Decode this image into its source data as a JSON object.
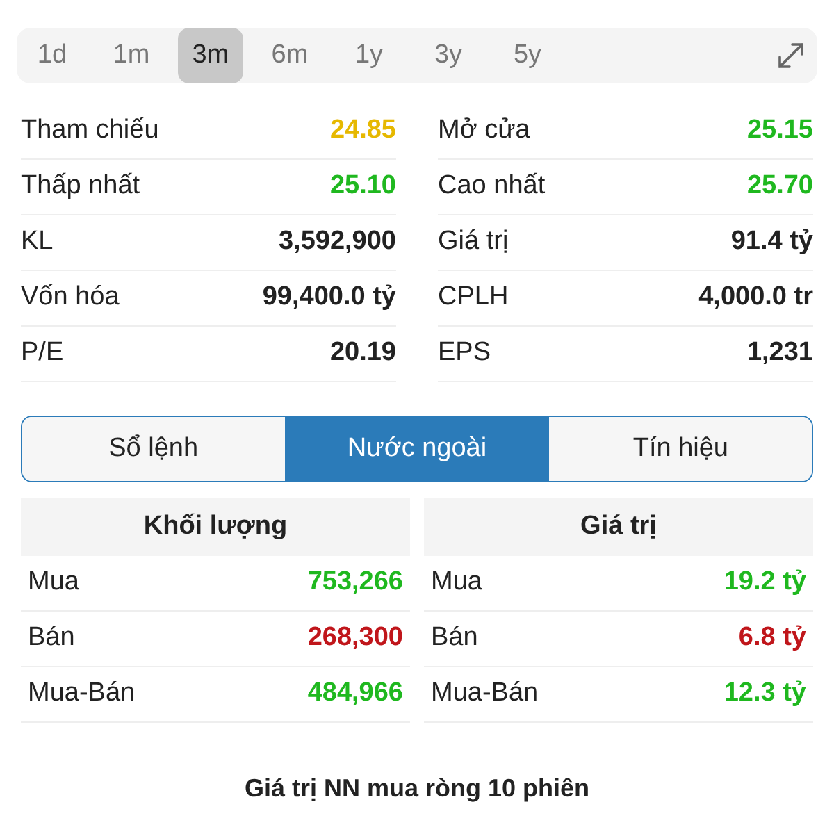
{
  "periods": [
    {
      "label": "1d",
      "selected": false
    },
    {
      "label": "1m",
      "selected": false
    },
    {
      "label": "3m",
      "selected": true
    },
    {
      "label": "6m",
      "selected": false
    },
    {
      "label": "1y",
      "selected": false
    },
    {
      "label": "3y",
      "selected": false
    },
    {
      "label": "5y",
      "selected": false
    }
  ],
  "stats_left": [
    {
      "label": "Tham chiếu",
      "value": "24.85",
      "color": "#e6b800"
    },
    {
      "label": "Thấp nhất",
      "value": "25.10",
      "color": "#1fb81f"
    },
    {
      "label": "KL",
      "value": "3,592,900",
      "color": "#222222"
    },
    {
      "label": "Vốn hóa",
      "value": "99,400.0 tỷ",
      "color": "#222222"
    },
    {
      "label": "P/E",
      "value": "20.19",
      "color": "#222222"
    }
  ],
  "stats_right": [
    {
      "label": "Mở cửa",
      "value": "25.15",
      "color": "#1fb81f"
    },
    {
      "label": "Cao nhất",
      "value": "25.70",
      "color": "#1fb81f"
    },
    {
      "label": "Giá trị",
      "value": "91.4 tỷ",
      "color": "#222222"
    },
    {
      "label": "CPLH",
      "value": "4,000.0 tr",
      "color": "#222222"
    },
    {
      "label": "EPS",
      "value": "1,231",
      "color": "#222222"
    }
  ],
  "tabs": [
    {
      "label": "Sổ lệnh",
      "selected": false
    },
    {
      "label": "Nước ngoài",
      "selected": true
    },
    {
      "label": "Tín hiệu",
      "selected": false
    }
  ],
  "tables": [
    {
      "header": "Khối lượng",
      "rows": [
        {
          "label": "Mua",
          "value": "753,266",
          "color": "#1fb81f"
        },
        {
          "label": "Bán",
          "value": "268,300",
          "color": "#c0161b"
        },
        {
          "label": "Mua-Bán",
          "value": "484,966",
          "color": "#1fb81f"
        }
      ]
    },
    {
      "header": "Giá trị",
      "rows": [
        {
          "label": "Mua",
          "value": "19.2 tỷ",
          "color": "#1fb81f"
        },
        {
          "label": "Bán",
          "value": "6.8 tỷ",
          "color": "#c0161b"
        },
        {
          "label": "Mua-Bán",
          "value": "12.3 tỷ",
          "color": "#1fb81f"
        }
      ]
    }
  ],
  "chart_title": "Giá trị NN mua ròng 10 phiên"
}
